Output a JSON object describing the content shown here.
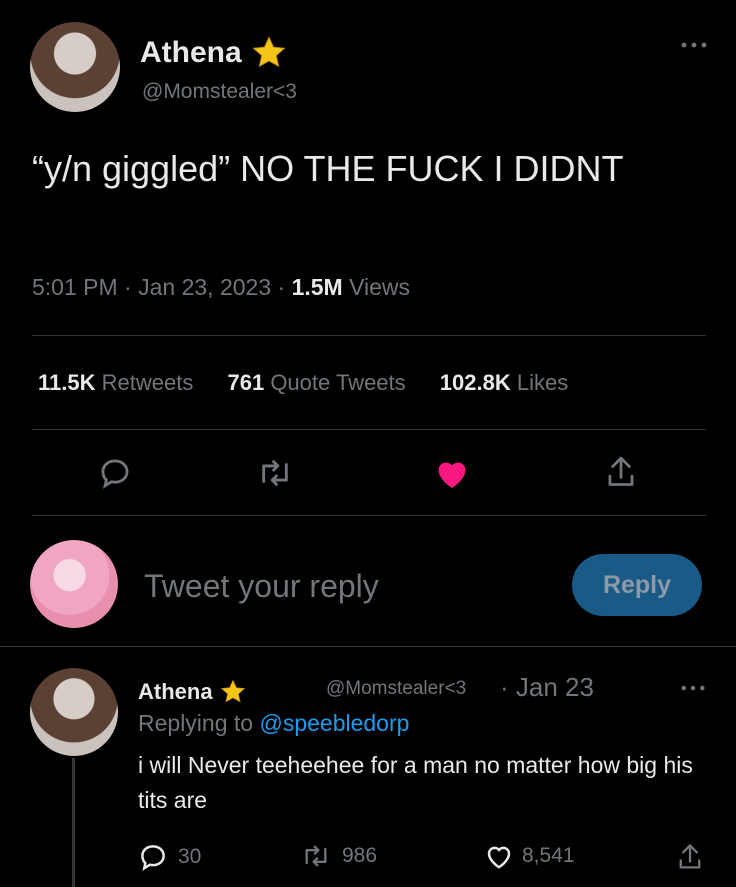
{
  "tweet": {
    "author_name": "Athena",
    "author_handle": "@Momstealer<3",
    "text": "“y/n giggled” NO THE FUCK I DIDNT",
    "time": "5:01 PM",
    "date": "Jan 23, 2023",
    "views_count": "1.5M",
    "views_label": "Views",
    "separator": "·"
  },
  "stats": {
    "retweets_count": "11.5K",
    "retweets_label": "Retweets",
    "quotes_count": "761",
    "quotes_label": "Quote Tweets",
    "likes_count": "102.8K",
    "likes_label": "Likes"
  },
  "reply_box": {
    "placeholder": "Tweet your reply",
    "button_label": "Reply"
  },
  "reply": {
    "author_name": "Athena",
    "author_handle": "@Momstealer<3",
    "date": "Jan 23",
    "separator": "·",
    "replying_prefix": "Replying to",
    "replying_to": "@speebledorp",
    "text": "i will Never teeheehee for a man no matter how big his tits are",
    "replies_count": "30",
    "retweets_count": "986",
    "likes_count": "8,541"
  },
  "colors": {
    "background": "#000000",
    "text": "#e7e9ea",
    "muted": "#71767b",
    "link": "#1d9bf0",
    "like_active": "#f91880",
    "reply_button": "#1a5a87",
    "star": "#f5c518"
  },
  "icons": [
    "star-icon",
    "more-icon",
    "reply-icon",
    "retweet-icon",
    "heart-icon",
    "share-icon"
  ]
}
